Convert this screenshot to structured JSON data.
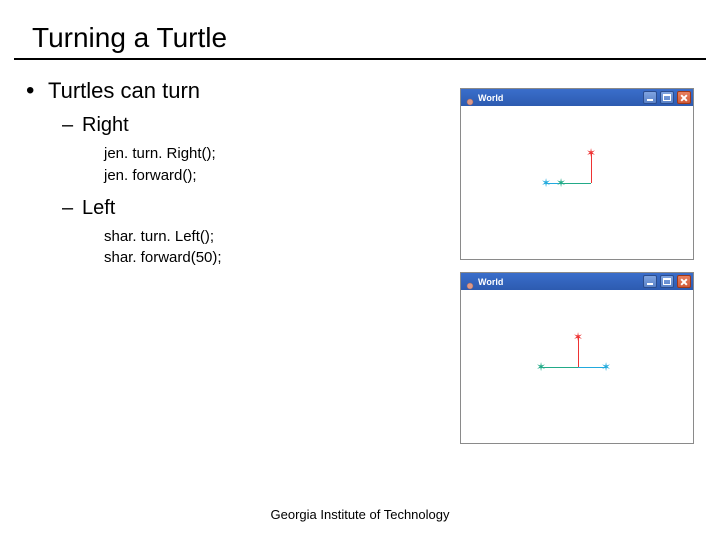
{
  "title": "Turning a Turtle",
  "main_bullet": "Turtles can turn",
  "sub1": "Right",
  "code1a": "jen. turn. Right();",
  "code1b": "jen. forward();",
  "sub2": "Left",
  "code2a": "shar. turn. Left();",
  "code2b": "shar. forward(50);",
  "footer": "Georgia Institute of Technology",
  "world_label": "World"
}
